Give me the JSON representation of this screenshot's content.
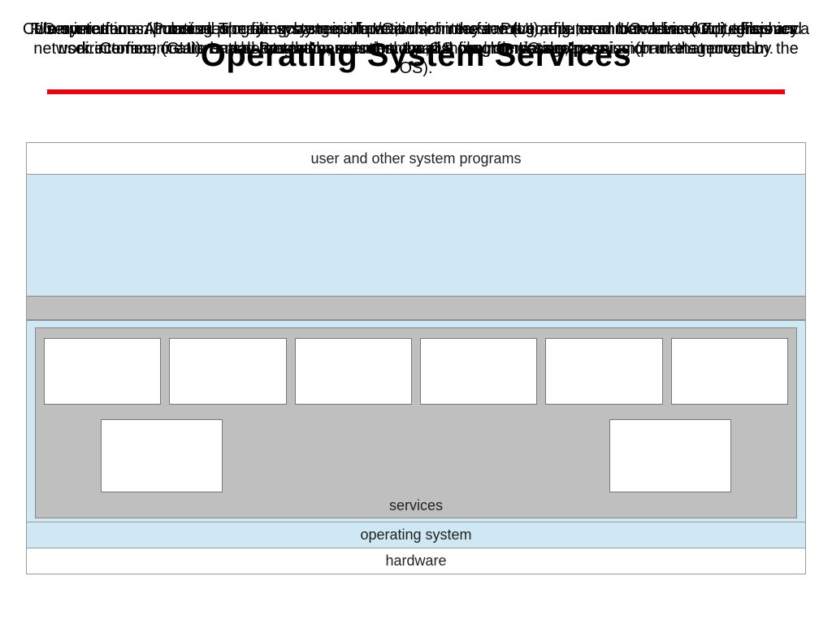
{
  "title": "Operating System Services",
  "overlapping_text": [
    "Communications. Processes may exchange information, on the same computer or between computers over a network. Communications may be via shared memory or through message passing (packets moved by the OS).",
    "I/O operations. A running program may require I/O, which may involve a file or an I/O device. For efficiency and protection reasons, the OS controls I/O devices.",
    "File-system manipulation. The file system is of particular interest. Programs need to read and write files and directories, create and delete them, search them, list file information, permission management.",
    "User interface. Almost all operating systems have a user interface (UI), e.g., command-line (CLI), graphics user interface (GUI), batch. Program execution. Load a program into memory and run that program."
  ],
  "diagram": {
    "row_user": "user and other system programs",
    "row_services_label": "services",
    "row_os": "operating system",
    "row_hw": "hardware"
  },
  "colors": {
    "accent_underline": "#e30613",
    "panel_blue": "#cfe8f3",
    "panel_gray": "#bfbfbf"
  }
}
